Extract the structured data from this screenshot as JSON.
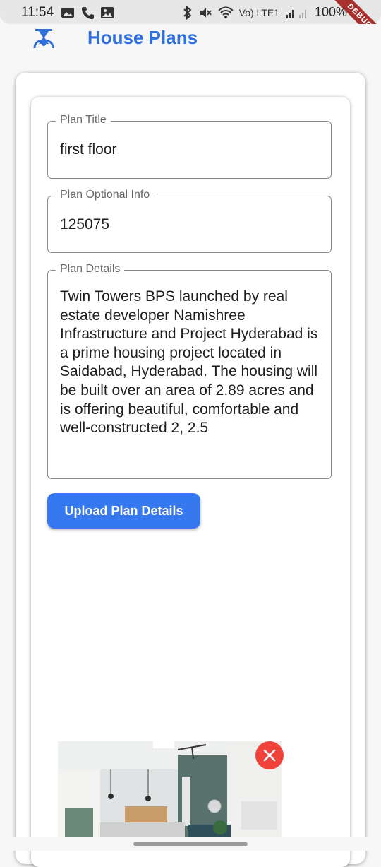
{
  "status_bar": {
    "time": "11:54",
    "right_text": "Vo) LTE1",
    "battery": "100%",
    "debug_label": "DEBUG"
  },
  "app_bar": {
    "title": "House Plans",
    "icon": "user-icon",
    "title_color": "#2f6fe0"
  },
  "form": {
    "plan_title": {
      "label": "Plan Title",
      "value": "first floor"
    },
    "plan_optional_info": {
      "label": "Plan Optional Info",
      "value": "125075"
    },
    "plan_details": {
      "label": "Plan Details",
      "value": "Twin Towers BPS launched by real estate developer Namishree Infrastructure and Project Hyderabad is a prime housing project located in Saidabad, Hyderabad. The housing will be built over an area of 2.89 acres and is offering beautiful, comfortable and well-constructed 2, 2.5"
    },
    "upload_label": "Upload Plan Details",
    "button_color": "#3578f0"
  },
  "preview": {
    "icon": "interior-photo",
    "remove_icon": "close-icon",
    "remove_color": "#f0413b"
  }
}
